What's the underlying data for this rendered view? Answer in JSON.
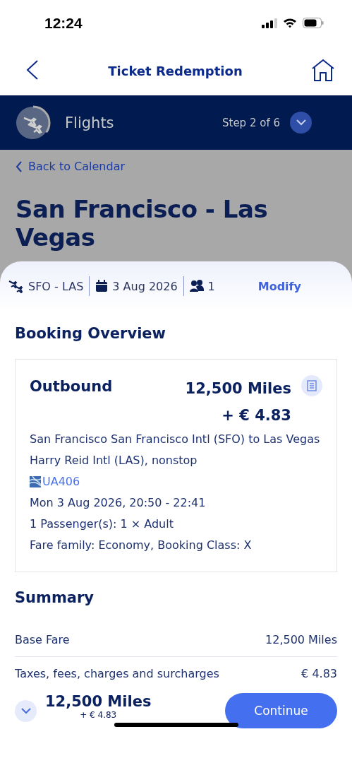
{
  "status_bar": {
    "time": "12:24"
  },
  "nav": {
    "title": "Ticket Redemption"
  },
  "step_bar": {
    "label": "Flights",
    "step": "Step 2 of 6",
    "level": 0.35,
    "expanded": false
  },
  "back_link": "Back to Calendar",
  "route_title": "San Francisco - Las Vegas",
  "trip_bar": {
    "route": "SFO - LAS",
    "date": "3 Aug 2026",
    "passengers": "1",
    "action": "Modify"
  },
  "booking_overview": {
    "heading": "Booking Overview",
    "segments": [
      {
        "title": "Outbound",
        "miles": "12,500 Miles",
        "cash": "+ € 4.83",
        "description": "San Francisco San Francisco Intl (SFO) to Las Vegas Harry Reid Intl (LAS), nonstop",
        "flight": "UA406",
        "details": [
          "Mon 3 Aug 2026, 20:50 - 22:41",
          "1 Passenger(s): 1 × Adult",
          "Fare family: Economy, Booking Class: X"
        ]
      }
    ]
  },
  "summary": {
    "heading": "Summary",
    "rows": [
      {
        "label": "Base Fare",
        "value": "12,500 Miles"
      },
      {
        "label": "Taxes, fees, charges and surcharges",
        "value": "€ 4.83"
      }
    ]
  },
  "footer": {
    "expanded": false,
    "miles": "12,500 Miles",
    "cash": "+ € 4.83",
    "button": "Continue"
  }
}
